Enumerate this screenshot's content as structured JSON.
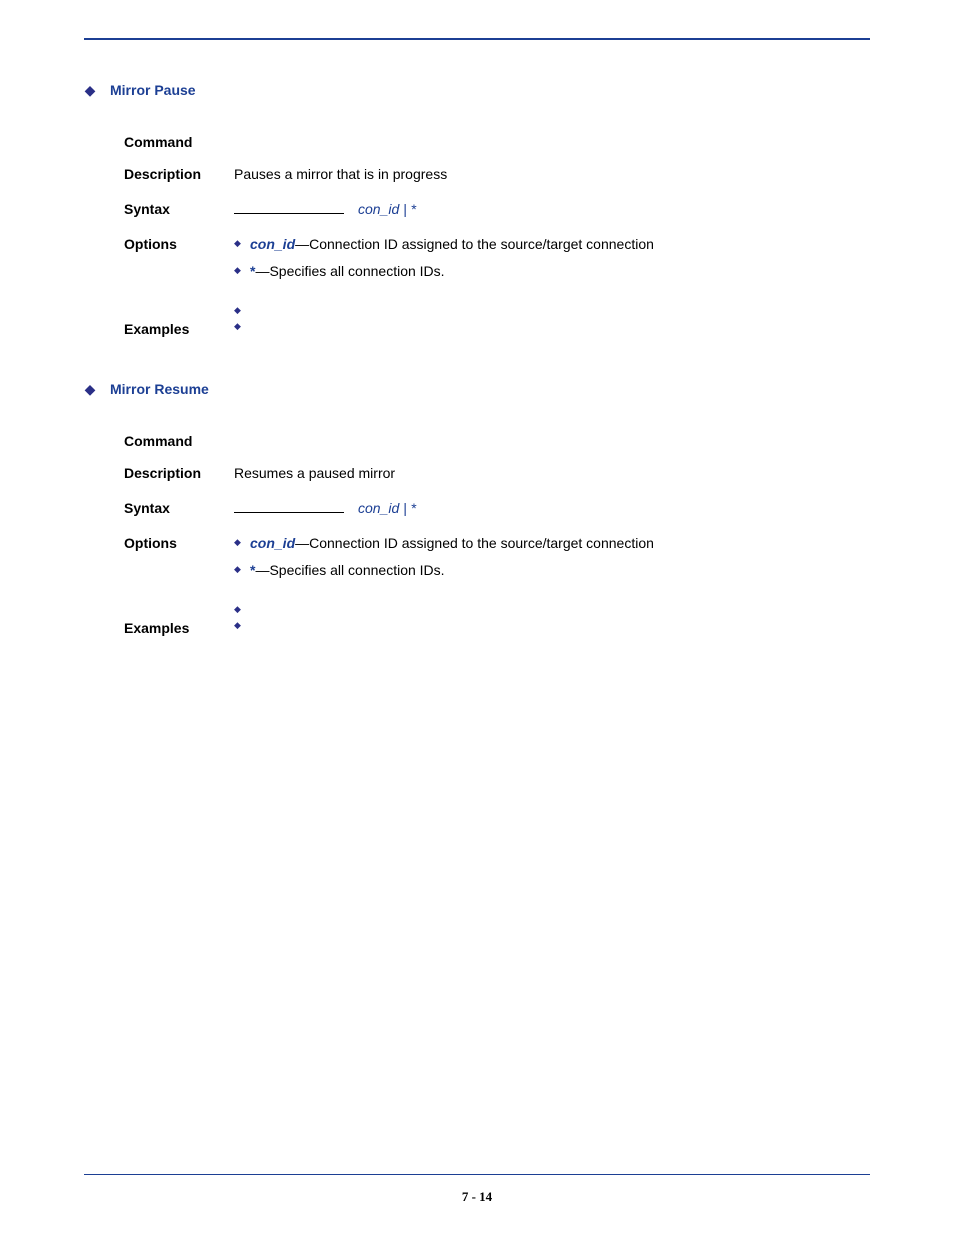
{
  "sections": [
    {
      "title": "Mirror Pause",
      "rows": {
        "command_label": "Command",
        "command_value": "",
        "description_label": "Description",
        "description_value": "Pauses a mirror that is in progress",
        "syntax_label": "Syntax",
        "syntax_arg": "con_id | *",
        "options_label": "Options",
        "options": [
          {
            "kw": "con_id",
            "kw_style": "em",
            "text": "—Connection ID assigned to the source/target connection"
          },
          {
            "kw": "*",
            "kw_style": "bold",
            "text": "—Specifies all connection IDs."
          }
        ],
        "examples_label": "Examples",
        "examples": [
          "",
          ""
        ]
      }
    },
    {
      "title": "Mirror Resume",
      "rows": {
        "command_label": "Command",
        "command_value": "",
        "description_label": "Description",
        "description_value": "Resumes a paused mirror",
        "syntax_label": "Syntax",
        "syntax_arg": "con_id | *",
        "options_label": "Options",
        "options": [
          {
            "kw": "con_id",
            "kw_style": "em",
            "text": "—Connection ID assigned to the source/target connection"
          },
          {
            "kw": "*",
            "kw_style": "bold",
            "text": "—Specifies all connection IDs."
          }
        ],
        "examples_label": "Examples",
        "examples": [
          "",
          ""
        ]
      }
    }
  ],
  "page_number": "7 - 14"
}
